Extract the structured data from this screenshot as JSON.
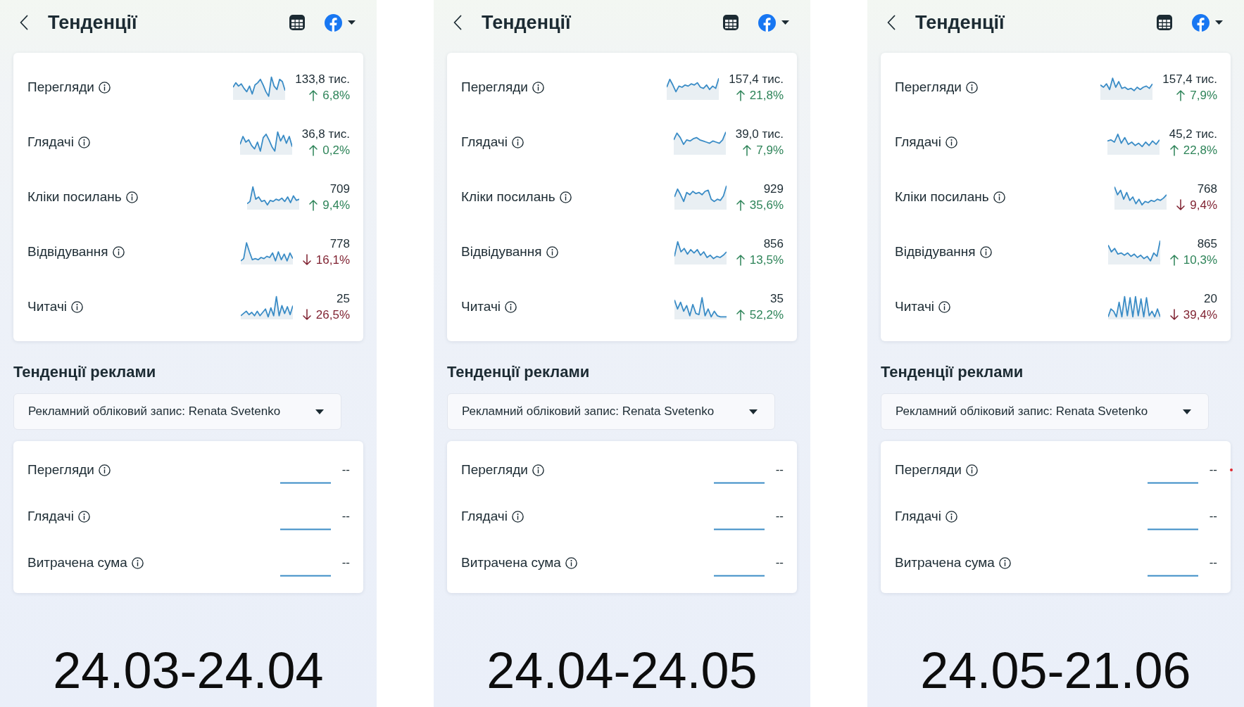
{
  "panels": [
    {
      "header": {
        "title": "Тенденції"
      },
      "metrics": [
        {
          "label": "Перегляди",
          "value": "133,8 тис.",
          "change": "6,8%",
          "increase": true
        },
        {
          "label": "Глядачі",
          "value": "36,8 тис.",
          "change": "0,2%",
          "increase": true
        },
        {
          "label": "Кліки посилань",
          "value": "709",
          "change": "9,4%",
          "increase": true
        },
        {
          "label": "Відвідування",
          "value": "778",
          "change": "16,1%",
          "increase": false
        },
        {
          "label": "Читачі",
          "value": "25",
          "change": "26,5%",
          "increase": false
        }
      ],
      "ads_section": {
        "title": "Тенденції реклами",
        "account_selector": "Рекламний обліковий запис: Renata Svetenko",
        "metrics": [
          {
            "label": "Перегляди",
            "value": "--"
          },
          {
            "label": "Глядачі",
            "value": "--"
          },
          {
            "label": "Витрачена сума",
            "value": "--"
          }
        ],
        "marker_dot": false
      },
      "period": "24.03-24.04"
    },
    {
      "header": {
        "title": "Тенденції"
      },
      "metrics": [
        {
          "label": "Перегляди",
          "value": "157,4 тис.",
          "change": "21,8%",
          "increase": true
        },
        {
          "label": "Глядачі",
          "value": "39,0 тис.",
          "change": "7,9%",
          "increase": true
        },
        {
          "label": "Кліки посилань",
          "value": "929",
          "change": "35,6%",
          "increase": true
        },
        {
          "label": "Відвідування",
          "value": "856",
          "change": "13,5%",
          "increase": true
        },
        {
          "label": "Читачі",
          "value": "35",
          "change": "52,2%",
          "increase": true
        }
      ],
      "ads_section": {
        "title": "Тенденції реклами",
        "account_selector": "Рекламний обліковий запис: Renata Svetenko",
        "metrics": [
          {
            "label": "Перегляди",
            "value": "--"
          },
          {
            "label": "Глядачі",
            "value": "--"
          },
          {
            "label": "Витрачена сума",
            "value": "--"
          }
        ],
        "marker_dot": false
      },
      "period": "24.04-24.05"
    },
    {
      "header": {
        "title": "Тенденції"
      },
      "metrics": [
        {
          "label": "Перегляди",
          "value": "157,4 тис.",
          "change": "7,9%",
          "increase": true
        },
        {
          "label": "Глядачі",
          "value": "45,2 тис.",
          "change": "22,8%",
          "increase": true
        },
        {
          "label": "Кліки посилань",
          "value": "768",
          "change": "9,4%",
          "increase": false
        },
        {
          "label": "Відвідування",
          "value": "865",
          "change": "10,3%",
          "increase": true
        },
        {
          "label": "Читачі",
          "value": "20",
          "change": "39,4%",
          "increase": false
        }
      ],
      "ads_section": {
        "title": "Тенденції реклами",
        "account_selector": "Рекламний обліковий запис: Renata Svetenko",
        "metrics": [
          {
            "label": "Перегляди",
            "value": "--"
          },
          {
            "label": "Глядачі",
            "value": "--"
          },
          {
            "label": "Витрачена сума",
            "value": "--"
          }
        ],
        "marker_dot": true
      },
      "period": "24.05-21.06"
    }
  ]
}
